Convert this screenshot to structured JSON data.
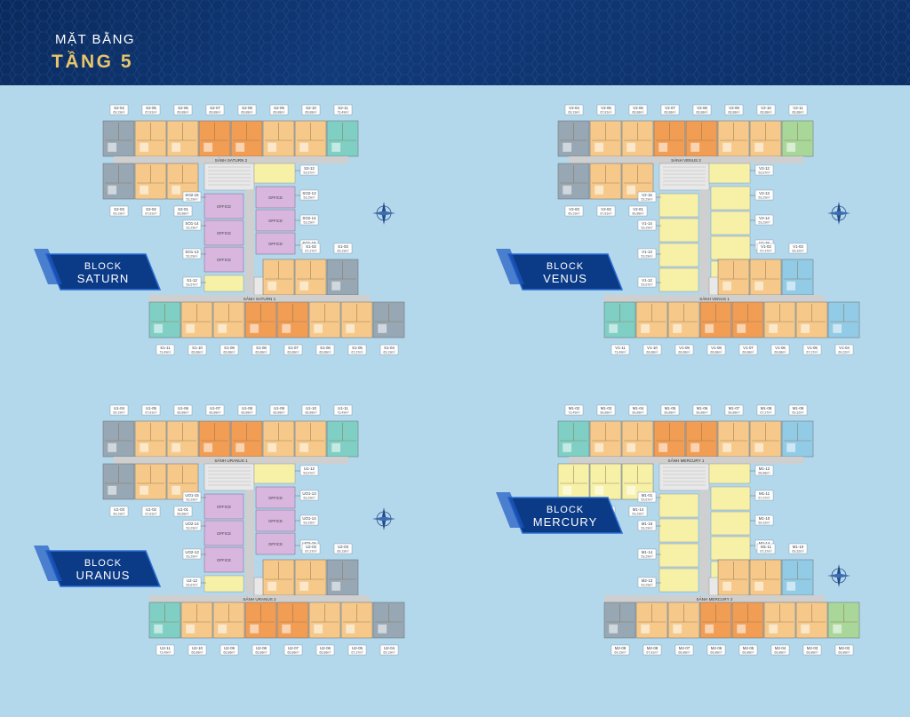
{
  "header": {
    "subtitle": "MẶT BẰNG",
    "title": "TẦNG 5"
  },
  "colors": {
    "background": "#b3d8ec",
    "header_bg": "#0d2f66",
    "title_gold": "#e7c56b",
    "unit_light": "#f6c98a",
    "unit_orange": "#f29d54",
    "unit_gray": "#97a7b4",
    "unit_teal": "#7fcfc4",
    "unit_green": "#a9d79a",
    "unit_blue": "#92cbe6",
    "unit_yellow": "#f7f1a8",
    "office_purple": "#d8b6de",
    "corridor": "#cfcfcf",
    "core": "#e8e8e8"
  },
  "blocks": [
    {
      "id": "saturn",
      "name": "SATURN",
      "label_prefix": "BLOCK",
      "lobby_top": "SẢNH SATURN 2",
      "lobby_bottom": "SẢNH SATURN 1",
      "core": "offices",
      "top_row": [
        {
          "code": "S2-04",
          "area": "69,19m²",
          "c": "unit_gray"
        },
        {
          "code": "S2-05",
          "area": "67,81m²",
          "c": "unit_light"
        },
        {
          "code": "S2-06",
          "area": "66,88m²",
          "c": "unit_light"
        },
        {
          "code": "S2-07",
          "area": "66,88m²",
          "c": "unit_orange"
        },
        {
          "code": "S2-08",
          "area": "66,88m²",
          "c": "unit_orange"
        },
        {
          "code": "S2-09",
          "area": "66,88m²",
          "c": "unit_light"
        },
        {
          "code": "S2-10",
          "area": "66,88m²",
          "c": "unit_light"
        },
        {
          "code": "S2-11",
          "area": "73,49m²",
          "c": "unit_teal"
        }
      ],
      "upper_left": [
        {
          "code": "S2-03",
          "area": "69,19m²",
          "c": "unit_gray"
        },
        {
          "code": "S2-02",
          "area": "67,81m²",
          "c": "unit_light"
        },
        {
          "code": "S2-01",
          "area": "66,88m²",
          "c": "unit_light"
        }
      ],
      "core_labels_left": [
        {
          "code": "SO2-15",
          "area": "53,29m²"
        },
        {
          "code": "SO1-14",
          "area": "53,29m²"
        },
        {
          "code": "SO1-13",
          "area": "53,29m²"
        },
        {
          "code": "S1-12",
          "area": "53,67m²"
        }
      ],
      "core_labels_right": [
        {
          "code": "S2-12",
          "area": "53,67m²"
        },
        {
          "code": "SO2-13",
          "area": "53,29m²"
        },
        {
          "code": "SO2-14",
          "area": "53,29m²"
        },
        {
          "code": "SO1-15",
          "area": "53,29m²"
        },
        {
          "code": "S1-01",
          "area": "66,88m²"
        }
      ],
      "lower_right": [
        {
          "code": "S1-01",
          "area": "66,88m²",
          "c": "unit_light"
        },
        {
          "code": "S1-02",
          "area": "67,37m²",
          "c": "unit_light"
        },
        {
          "code": "S1-03",
          "area": "69,19m²",
          "c": "unit_gray"
        }
      ],
      "bottom_row": [
        {
          "code": "S1-11",
          "area": "73,49m²",
          "c": "unit_teal"
        },
        {
          "code": "S1-10",
          "area": "66,88m²",
          "c": "unit_light"
        },
        {
          "code": "S1-09",
          "area": "66,88m²",
          "c": "unit_light"
        },
        {
          "code": "S1-08",
          "area": "66,88m²",
          "c": "unit_orange"
        },
        {
          "code": "S1-07",
          "area": "66,88m²",
          "c": "unit_orange"
        },
        {
          "code": "S1-06",
          "area": "66,88m²",
          "c": "unit_light"
        },
        {
          "code": "S1-05",
          "area": "67,37m²",
          "c": "unit_light"
        },
        {
          "code": "S1-04",
          "area": "69,19m²",
          "c": "unit_gray"
        }
      ]
    },
    {
      "id": "venus",
      "name": "VENUS",
      "label_prefix": "BLOCK",
      "lobby_top": "SẢNH VENUS 2",
      "lobby_bottom": "SẢNH VENUS 1",
      "core": "apartments",
      "top_row": [
        {
          "code": "V2-04",
          "area": "69,19m²",
          "c": "unit_gray"
        },
        {
          "code": "V2-05",
          "area": "67,81m²",
          "c": "unit_light"
        },
        {
          "code": "V2-06",
          "area": "66,88m²",
          "c": "unit_light"
        },
        {
          "code": "V2-07",
          "area": "66,88m²",
          "c": "unit_orange"
        },
        {
          "code": "V2-08",
          "area": "66,88m²",
          "c": "unit_orange"
        },
        {
          "code": "V2-09",
          "area": "66,88m²",
          "c": "unit_light"
        },
        {
          "code": "V2-10",
          "area": "66,88m²",
          "c": "unit_light"
        },
        {
          "code": "V2-11",
          "area": "66,88m²",
          "c": "unit_green"
        }
      ],
      "upper_left": [
        {
          "code": "V2-03",
          "area": "69,19m²",
          "c": "unit_gray"
        },
        {
          "code": "V2-02",
          "area": "67,81m²",
          "c": "unit_light"
        },
        {
          "code": "V2-01",
          "area": "66,88m²",
          "c": "unit_light"
        }
      ],
      "core_labels_left": [
        {
          "code": "V2-15",
          "area": "53,29m²"
        },
        {
          "code": "V1-14",
          "area": "53,29m²"
        },
        {
          "code": "V1-13",
          "area": "53,29m²"
        },
        {
          "code": "V1-12",
          "area": "53,67m²"
        }
      ],
      "core_labels_right": [
        {
          "code": "V2-12",
          "area": "53,67m²"
        },
        {
          "code": "V2-13",
          "area": "53,29m²"
        },
        {
          "code": "V2-14",
          "area": "53,29m²"
        },
        {
          "code": "V1-15",
          "area": "53,29m²"
        },
        {
          "code": "V1-01",
          "area": "66,88m²"
        }
      ],
      "lower_right": [
        {
          "code": "V1-01",
          "area": "66,88m²",
          "c": "unit_light"
        },
        {
          "code": "V1-02",
          "area": "67,37m²",
          "c": "unit_light"
        },
        {
          "code": "V1-03",
          "area": "69,32m²",
          "c": "unit_blue"
        }
      ],
      "bottom_row": [
        {
          "code": "V1-11",
          "area": "73,49m²",
          "c": "unit_teal"
        },
        {
          "code": "V1-10",
          "area": "66,88m²",
          "c": "unit_light"
        },
        {
          "code": "V1-09",
          "area": "66,88m²",
          "c": "unit_light"
        },
        {
          "code": "V1-08",
          "area": "66,88m²",
          "c": "unit_orange"
        },
        {
          "code": "V1-07",
          "area": "66,88m²",
          "c": "unit_orange"
        },
        {
          "code": "V1-06",
          "area": "66,88m²",
          "c": "unit_light"
        },
        {
          "code": "V1-05",
          "area": "67,37m²",
          "c": "unit_light"
        },
        {
          "code": "V1-04",
          "area": "69,32m²",
          "c": "unit_blue"
        }
      ]
    },
    {
      "id": "uranus",
      "name": "URANUS",
      "label_prefix": "BLOCK",
      "lobby_top": "SẢNH URANUS 1",
      "lobby_bottom": "SẢNH URANUS 2",
      "core": "offices",
      "top_row": [
        {
          "code": "U1-04",
          "area": "69,19m²",
          "c": "unit_gray"
        },
        {
          "code": "U1-05",
          "area": "67,81m²",
          "c": "unit_light"
        },
        {
          "code": "U1-06",
          "area": "66,88m²",
          "c": "unit_light"
        },
        {
          "code": "U1-07",
          "area": "66,88m²",
          "c": "unit_orange"
        },
        {
          "code": "U1-08",
          "area": "66,88m²",
          "c": "unit_orange"
        },
        {
          "code": "U1-09",
          "area": "66,88m²",
          "c": "unit_light"
        },
        {
          "code": "U1-10",
          "area": "66,88m²",
          "c": "unit_light"
        },
        {
          "code": "U1-11",
          "area": "73,49m²",
          "c": "unit_teal"
        }
      ],
      "upper_left": [
        {
          "code": "U1-03",
          "area": "69,19m²",
          "c": "unit_gray"
        },
        {
          "code": "U1-02",
          "area": "67,81m²",
          "c": "unit_light"
        },
        {
          "code": "U1-01",
          "area": "66,88m²",
          "c": "unit_light"
        }
      ],
      "core_labels_left": [
        {
          "code": "UO1-15",
          "area": "53,29m²"
        },
        {
          "code": "UO2-14",
          "area": "53,29m²"
        },
        {
          "code": "UO2-13",
          "area": "53,29m²"
        },
        {
          "code": "U2-12",
          "area": "53,67m²"
        }
      ],
      "core_labels_right": [
        {
          "code": "U1-12",
          "area": "53,67m²"
        },
        {
          "code": "UO1-13",
          "area": "53,29m²"
        },
        {
          "code": "UO1-14",
          "area": "53,29m²"
        },
        {
          "code": "UO2-15",
          "area": "53,29m²"
        },
        {
          "code": "U2-01",
          "area": "66,88m²"
        }
      ],
      "lower_right": [
        {
          "code": "U2-01",
          "area": "66,88m²",
          "c": "unit_light"
        },
        {
          "code": "U2-02",
          "area": "67,37m²",
          "c": "unit_light"
        },
        {
          "code": "U2-03",
          "area": "69,19m²",
          "c": "unit_gray"
        }
      ],
      "bottom_row": [
        {
          "code": "U2-11",
          "area": "73,49m²",
          "c": "unit_teal"
        },
        {
          "code": "U2-10",
          "area": "66,88m²",
          "c": "unit_light"
        },
        {
          "code": "U2-09",
          "area": "66,88m²",
          "c": "unit_light"
        },
        {
          "code": "U2-08",
          "area": "66,88m²",
          "c": "unit_orange"
        },
        {
          "code": "U2-07",
          "area": "66,88m²",
          "c": "unit_orange"
        },
        {
          "code": "U2-06",
          "area": "66,88m²",
          "c": "unit_light"
        },
        {
          "code": "U2-05",
          "area": "67,37m²",
          "c": "unit_light"
        },
        {
          "code": "U2-04",
          "area": "69,19m²",
          "c": "unit_gray"
        }
      ]
    },
    {
      "id": "mercury",
      "name": "MERCURY",
      "label_prefix": "BLOCK",
      "lobby_top": "SẢNH MERCURY 1",
      "lobby_bottom": "SẢNH MERCURY 2",
      "core": "apartments",
      "top_row": [
        {
          "code": "M1-02",
          "area": "73,49m²",
          "c": "unit_teal"
        },
        {
          "code": "M1-03",
          "area": "66,88m²",
          "c": "unit_light"
        },
        {
          "code": "M1-04",
          "area": "66,88m²",
          "c": "unit_light"
        },
        {
          "code": "M1-05",
          "area": "66,88m²",
          "c": "unit_orange"
        },
        {
          "code": "M1-06",
          "area": "66,88m²",
          "c": "unit_orange"
        },
        {
          "code": "M1-07",
          "area": "66,88m²",
          "c": "unit_light"
        },
        {
          "code": "M1-08",
          "area": "67,37m²",
          "c": "unit_light"
        },
        {
          "code": "M1-09",
          "area": "69,32m²",
          "c": "unit_blue"
        }
      ],
      "upper_left": [
        {
          "code": "M1-01",
          "area": "53,67m²",
          "c": "unit_yellow"
        },
        {
          "code": "M1-15",
          "area": "53,29m²",
          "c": "unit_yellow"
        },
        {
          "code": "M1-14",
          "area": "53,29m²",
          "c": "unit_yellow"
        }
      ],
      "core_labels_left": [
        {
          "code": "M1-01",
          "area": "53,67m²"
        },
        {
          "code": "M1-15",
          "area": "53,29m²"
        },
        {
          "code": "M1-14",
          "area": "53,29m²"
        },
        {
          "code": "M2-13",
          "area": "53,29m²"
        },
        {
          "code": "M2-12",
          "area": "53,67m²"
        }
      ],
      "core_labels_right": [
        {
          "code": "M1-12",
          "area": "66,88m²"
        },
        {
          "code": "M1-11",
          "area": "67,37m²"
        },
        {
          "code": "M1-10",
          "area": "69,32m²"
        },
        {
          "code": "M2-14",
          "area": "53,29m²"
        },
        {
          "code": "M2-15",
          "area": "53,29m²"
        },
        {
          "code": "M2-01",
          "area": "53,67m²"
        }
      ],
      "lower_right": [
        {
          "code": "M1-12",
          "area": "66,88m²",
          "c": "unit_light"
        },
        {
          "code": "M1-11",
          "area": "67,37m²",
          "c": "unit_light"
        },
        {
          "code": "M1-10",
          "area": "69,32m²",
          "c": "unit_blue"
        }
      ],
      "upper_left_extra": [
        {
          "code": "M2-10",
          "area": "69,19m²",
          "c": "unit_gray"
        },
        {
          "code": "M2-11",
          "area": "67,81m²",
          "c": "unit_light"
        }
      ],
      "bottom_row": [
        {
          "code": "M2-09",
          "area": "69,19m²",
          "c": "unit_gray"
        },
        {
          "code": "M2-08",
          "area": "67,81m²",
          "c": "unit_light"
        },
        {
          "code": "M2-07",
          "area": "66,88m²",
          "c": "unit_light"
        },
        {
          "code": "M2-06",
          "area": "66,88m²",
          "c": "unit_orange"
        },
        {
          "code": "M2-05",
          "area": "66,88m²",
          "c": "unit_orange"
        },
        {
          "code": "M2-04",
          "area": "66,88m²",
          "c": "unit_light"
        },
        {
          "code": "M2-03",
          "area": "66,88m²",
          "c": "unit_light"
        },
        {
          "code": "M2-02",
          "area": "66,88m²",
          "c": "unit_green"
        }
      ]
    }
  ],
  "office_label": "OFFICE",
  "compass_label": "N"
}
